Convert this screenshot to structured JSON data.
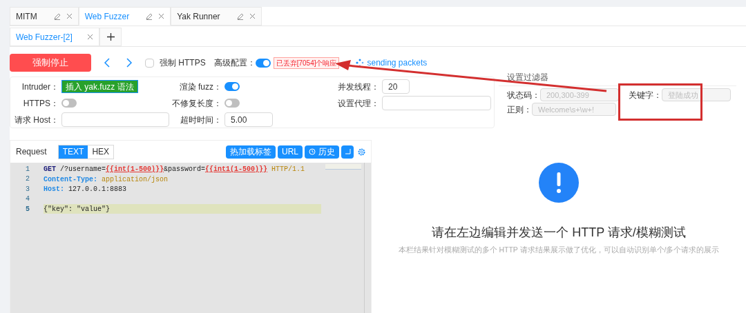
{
  "tabs": [
    {
      "label": "MITM",
      "selected": false
    },
    {
      "label": "Web Fuzzer",
      "selected": true
    },
    {
      "label": "Yak Runner",
      "selected": false
    }
  ],
  "sub_tabs": [
    {
      "label": "Web Fuzzer-[2]",
      "selected": true
    }
  ],
  "toolbar": {
    "stop_button": "强制停止",
    "force_https": {
      "label": "强制 HTTPS",
      "checked": false
    },
    "advanced": {
      "label": "高级配置：",
      "on": true
    },
    "dropped_badge": "已丢弃[7054]个响应",
    "status": "sending packets"
  },
  "config": {
    "intruder_label": "Intruder：",
    "intruder_button": "插入 yak.fuzz 语法",
    "https": {
      "label": "HTTPS：",
      "on": false
    },
    "host_label": "请求 Host：",
    "render_fuzz": {
      "label": "渲染 fuzz：",
      "on": true
    },
    "no_fix_length": {
      "label": "不修复长度：",
      "on": false
    },
    "timeout": {
      "label": "超时时间：",
      "value": "5.00"
    },
    "threads": {
      "label": "并发线程：",
      "value": "20"
    },
    "proxy_label": "设置代理："
  },
  "filter": {
    "title": "设置过滤器",
    "status_code": {
      "label": "状态码：",
      "placeholder": "200,300-399"
    },
    "regex": {
      "label": "正则：",
      "placeholder": "Welcome\\s+\\w+!"
    },
    "keyword": {
      "label": "关键字：",
      "placeholder": "登陆成功"
    }
  },
  "request": {
    "title": "Request",
    "modes": [
      {
        "label": "TEXT",
        "selected": true
      },
      {
        "label": "HEX",
        "selected": false
      }
    ],
    "buttons": [
      "热加载标签",
      "URL",
      "历史"
    ],
    "lines": [
      {
        "number": "1",
        "highlighted": false,
        "segments": [
          {
            "kind": "method",
            "text": "GET"
          },
          {
            "kind": "plain",
            "text": " /?username="
          },
          {
            "kind": "fuzz",
            "text": "{{int(1-500)}}"
          },
          {
            "kind": "plain",
            "text": "&password="
          },
          {
            "kind": "fuzz",
            "text": "{{int1(1-500)}}"
          },
          {
            "kind": "version",
            "text": " HTTP/1.1"
          }
        ]
      },
      {
        "number": "2",
        "highlighted": false,
        "segments": [
          {
            "kind": "key",
            "text": "Content-Type:"
          },
          {
            "kind": "value",
            "text": " application/json"
          }
        ]
      },
      {
        "number": "3",
        "highlighted": false,
        "segments": [
          {
            "kind": "key",
            "text": "Host:"
          },
          {
            "kind": "plain",
            "text": " 127.0.0.1:8883"
          }
        ]
      },
      {
        "number": "4",
        "highlighted": false
      },
      {
        "number": "5",
        "highlighted": true,
        "segments": [
          {
            "kind": "plain",
            "text": "{\"key\": \"value\"}"
          }
        ]
      }
    ]
  },
  "result": {
    "title": "请在左边编辑并发送一个 HTTP 请求/模糊测试",
    "subtitle": "本栏结果针对模糊测试的多个 HTTP 请求结果展示做了优化，可以自动识别单个/多个请求的展示"
  }
}
